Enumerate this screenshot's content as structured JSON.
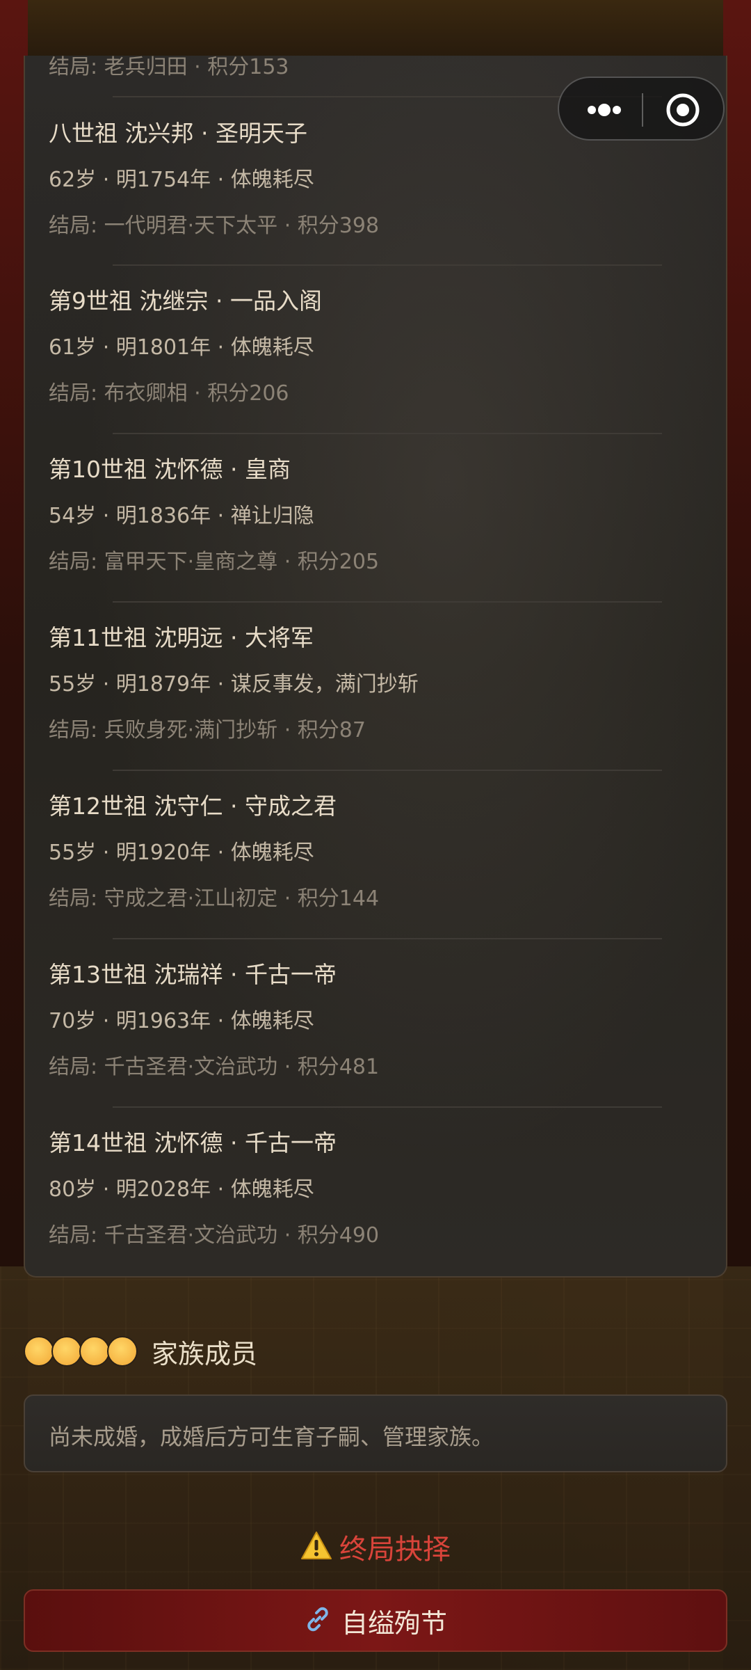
{
  "capsule": {
    "more_icon": "more-dots-icon",
    "close_icon": "target-close-icon"
  },
  "ancestors": [
    {
      "title": "",
      "stats": "",
      "result": "结局: 老兵归田 · 积分153"
    },
    {
      "title": "八世祖 沈兴邦 · 圣明天子",
      "stats": "62岁 · 明1754年 · 体魄耗尽",
      "result": "结局: 一代明君·天下太平 · 积分398"
    },
    {
      "title": "第9世祖 沈继宗 · 一品入阁",
      "stats": "61岁 · 明1801年 · 体魄耗尽",
      "result": "结局: 布衣卿相 · 积分206"
    },
    {
      "title": "第10世祖 沈怀德 · 皇商",
      "stats": "54岁 · 明1836年 · 禅让归隐",
      "result": "结局: 富甲天下·皇商之尊 · 积分205"
    },
    {
      "title": "第11世祖 沈明远 · 大将军",
      "stats": "55岁 · 明1879年 · 谋反事发，满门抄斩",
      "result": "结局: 兵败身死·满门抄斩 · 积分87"
    },
    {
      "title": "第12世祖 沈守仁 · 守成之君",
      "stats": "55岁 · 明1920年 · 体魄耗尽",
      "result": "结局: 守成之君·江山初定 · 积分144"
    },
    {
      "title": "第13世祖 沈瑞祥 · 千古一帝",
      "stats": "70岁 · 明1963年 · 体魄耗尽",
      "result": "结局: 千古圣君·文治武功 · 积分481"
    },
    {
      "title": "第14世祖 沈怀德 · 千古一帝",
      "stats": "80岁 · 明2028年 · 体魄耗尽",
      "result": "结局: 千古圣君·文治武功 · 积分490"
    }
  ],
  "family": {
    "icon": "family-faces-icon",
    "label": "家族成员",
    "note": "尚未成婚，成婚后方可生育子嗣、管理家族。"
  },
  "final_choice": {
    "icon": "warning-icon",
    "label": "终局抉择"
  },
  "action": {
    "icon": "link-icon",
    "label": "自缢殉节"
  }
}
